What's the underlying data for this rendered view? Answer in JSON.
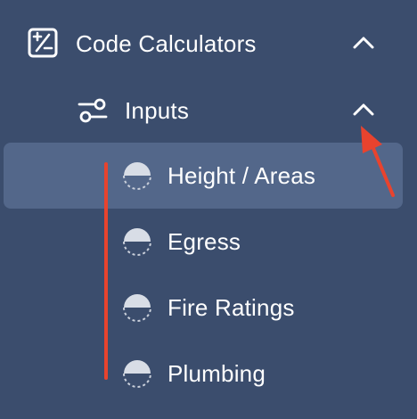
{
  "sidebar": {
    "section": {
      "label": "Code Calculators",
      "icon": "calculator-icon",
      "expanded": true
    },
    "group": {
      "label": "Inputs",
      "icon": "sliders-icon",
      "expanded": true
    },
    "items": [
      {
        "label": "Height / Areas",
        "icon": "half-filled-circle-icon",
        "active": true
      },
      {
        "label": "Egress",
        "icon": "half-filled-circle-icon",
        "active": false
      },
      {
        "label": "Fire Ratings",
        "icon": "half-filled-circle-icon",
        "active": false
      },
      {
        "label": "Plumbing",
        "icon": "half-filled-circle-icon",
        "active": false
      }
    ]
  },
  "colors": {
    "background": "#3b4d6d",
    "active_background": "#53678a",
    "text": "#ffffff",
    "annotation": "#e8432e"
  }
}
